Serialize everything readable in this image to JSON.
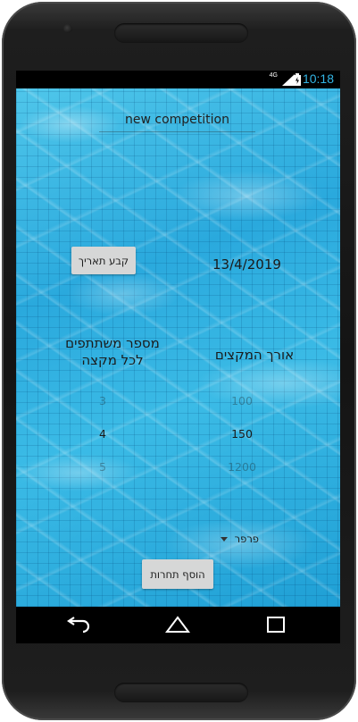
{
  "status_bar": {
    "network_label": "4G",
    "time": "10:18"
  },
  "competition": {
    "name": "new competition"
  },
  "date": {
    "button_label": "קבע תאריך",
    "value": "13/4/2019"
  },
  "participants": {
    "label": "מספר משתתפים לכל מקצה",
    "picker": {
      "prev": "3",
      "selected": "4",
      "next": "5"
    }
  },
  "length": {
    "label": "אורך המקצים",
    "picker": {
      "prev": "100",
      "selected": "150",
      "next": "1200"
    }
  },
  "stroke": {
    "selected": "פרפר"
  },
  "actions": {
    "add_label": "הוסף תחרות"
  },
  "colors": {
    "accent": "#33b5e5",
    "button_bg": "#d6d7d7",
    "water": "#2aa9dd"
  },
  "nav": {
    "back": "back-icon",
    "home": "home-icon",
    "recent": "recent-apps-icon"
  }
}
